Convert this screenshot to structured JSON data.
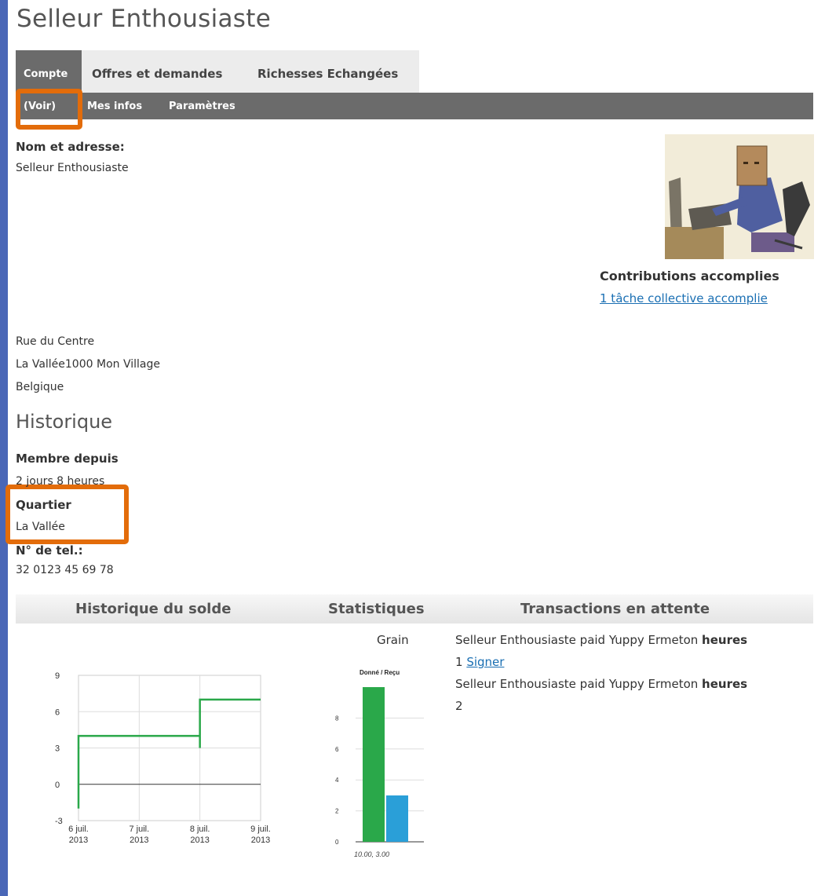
{
  "page": {
    "title": "Selleur Enthousiaste"
  },
  "tabs": [
    {
      "label": "Compte"
    },
    {
      "label": "Offres et demandes"
    },
    {
      "label": "Richesses Echangées"
    }
  ],
  "subtabs": [
    {
      "label": "(Voir)"
    },
    {
      "label": "Mes infos"
    },
    {
      "label": "Paramètres"
    }
  ],
  "profile": {
    "name_label": "Nom et adresse:",
    "name": "Selleur  Enthousiaste",
    "address": [
      "Rue du Centre",
      "La Vallée1000  Mon Village",
      "Belgique"
    ],
    "contributions_label": "Contributions accomplies",
    "contributions_link": "1 tâche collective accomplie"
  },
  "historique": {
    "heading": "Historique",
    "member_since_label": "Membre depuis",
    "member_since": "2 jours 8 heures",
    "quartier_label": "Quartier",
    "quartier": "La Vallée",
    "phone_label": "N° de tel.:",
    "phone": "32 0123 45 69 78"
  },
  "columns": {
    "balance": "Historique du solde",
    "stats": "Statistiques",
    "pending": "Transactions en attente"
  },
  "stats": {
    "currency": "Grain"
  },
  "pending": {
    "items": [
      {
        "text": "Selleur Enthousiaste paid Yuppy Ermeton ",
        "unit": "heures",
        "amount": "1",
        "action": "Signer"
      },
      {
        "text": "Selleur Enthousiaste paid Yuppy Ermeton ",
        "unit": "heures",
        "amount": "2",
        "action": ""
      }
    ]
  },
  "colors": {
    "accent": "#e36c0a",
    "green": "#2aa84a",
    "blue": "#2a9fd8",
    "nav": "#6b6b6b"
  },
  "chart_data": [
    {
      "type": "line",
      "title": "",
      "x": [
        "6 juil. 2013",
        "7 juil. 2013",
        "8 juil. 2013",
        "9 juil. 2013"
      ],
      "xticks": [
        [
          "6 juil.",
          "2013"
        ],
        [
          "7 juil.",
          "2013"
        ],
        [
          "8 juil.",
          "2013"
        ],
        [
          "9 juil.",
          "2013"
        ]
      ],
      "yticks": [
        "9",
        "6",
        "3",
        "0",
        "-3"
      ],
      "ylim": [
        -3,
        9
      ],
      "step_series": [
        {
          "x": 0.0,
          "y": -2
        },
        {
          "x": 0.0,
          "y": 4
        },
        {
          "x": 2.0,
          "y": 4
        },
        {
          "x": 2.0,
          "y": 3
        },
        {
          "x": 2.0,
          "y": 7
        },
        {
          "x": 3.0,
          "y": 7
        }
      ],
      "grid": true
    },
    {
      "type": "bar",
      "title": "Donné / Reçu",
      "categories": [
        "Donné",
        "Reçu"
      ],
      "values": [
        10.0,
        3.0
      ],
      "ylim": [
        0,
        10
      ],
      "yticks": [
        "8",
        "6",
        "4",
        "2",
        "0"
      ],
      "caption": "10.00, 3.00"
    }
  ]
}
